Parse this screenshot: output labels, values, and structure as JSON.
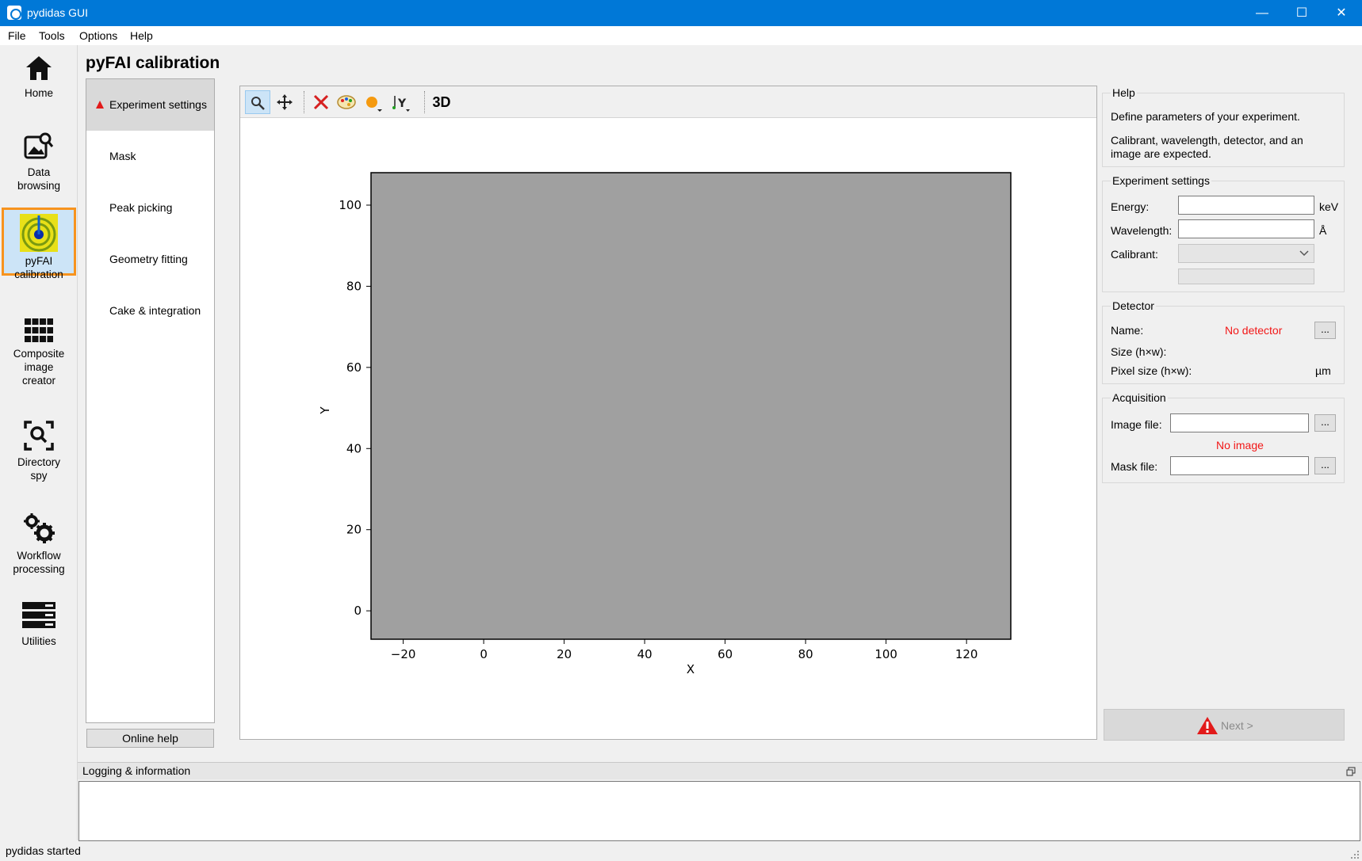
{
  "window": {
    "title": "pydidas GUI",
    "minimize": "—",
    "maximize": "☐",
    "close": "✕"
  },
  "menubar": [
    "File",
    "Tools",
    "Options",
    "Help"
  ],
  "sidebar": {
    "items": [
      {
        "label_lines": [
          "Home"
        ],
        "icon": "home-icon"
      },
      {
        "label_lines": [
          "Data",
          "browsing"
        ],
        "icon": "image-search-icon"
      },
      {
        "label_lines": [
          "pyFAI",
          "calibration"
        ],
        "icon": "pyfai-rings-icon",
        "active": true
      },
      {
        "label_lines": [
          "Composite",
          "image",
          "creator"
        ],
        "icon": "grid-icon"
      },
      {
        "label_lines": [
          "Directory",
          "spy"
        ],
        "icon": "scan-search-icon"
      },
      {
        "label_lines": [
          "Workflow",
          "processing"
        ],
        "icon": "gears-icon"
      },
      {
        "label_lines": [
          "Utilities"
        ],
        "icon": "server-stack-icon"
      }
    ]
  },
  "page": {
    "title": "pyFAI calibration"
  },
  "tabs": [
    {
      "label": "Experiment settings",
      "active": true,
      "warning": true
    },
    {
      "label": "Mask"
    },
    {
      "label": "Peak picking"
    },
    {
      "label": "Geometry fitting"
    },
    {
      "label": "Cake & integration"
    }
  ],
  "online_help": "Online help",
  "plot_toolbar": {
    "zoom": "zoom-icon",
    "pan": "pan-icon",
    "reset": "reset-zoom-icon",
    "colormap": "colormap-icon",
    "marker": "marker-icon",
    "yaxis": "y-axis-icon",
    "label_3d": "3D"
  },
  "chart_data": {
    "type": "heatmap",
    "xlabel": "X",
    "ylabel": "Y",
    "xlim": [
      -28,
      131
    ],
    "ylim": [
      -7,
      108
    ],
    "xticks": [
      -20,
      0,
      20,
      40,
      60,
      80,
      100,
      120
    ],
    "yticks": [
      0,
      20,
      40,
      60,
      80,
      100
    ],
    "fill_color": "#a0a0a0",
    "grid": false
  },
  "help": {
    "title": "Help",
    "lines": [
      "Define parameters of your experiment.",
      "Calibrant, wavelength, detector, and an",
      "image are expected."
    ]
  },
  "experiment": {
    "title": "Experiment settings",
    "energy_label": "Energy:",
    "energy_value": "",
    "energy_unit": "keV",
    "wavelength_label": "Wavelength:",
    "wavelength_value": "",
    "wavelength_unit": "Å",
    "calibrant_label": "Calibrant:",
    "calibrant_value": ""
  },
  "detector": {
    "title": "Detector",
    "name_label": "Name:",
    "name_value": "No detector",
    "size_label": "Size (h×w):",
    "pixel_label": "Pixel size (h×w):",
    "pixel_unit": "µm",
    "browse": "..."
  },
  "acquisition": {
    "title": "Acquisition",
    "image_label": "Image file:",
    "image_value": "",
    "no_image": "No image",
    "mask_label": "Mask file:",
    "mask_value": "",
    "browse": "..."
  },
  "next_button": "Next >",
  "logging": {
    "title": "Logging & information",
    "content": ""
  },
  "status": "pydidas started",
  "colors": {
    "titlebar": "#0078d7",
    "active_border": "#f7931e",
    "warning": "#e21a1a",
    "image_fill": "#a0a0a0"
  }
}
